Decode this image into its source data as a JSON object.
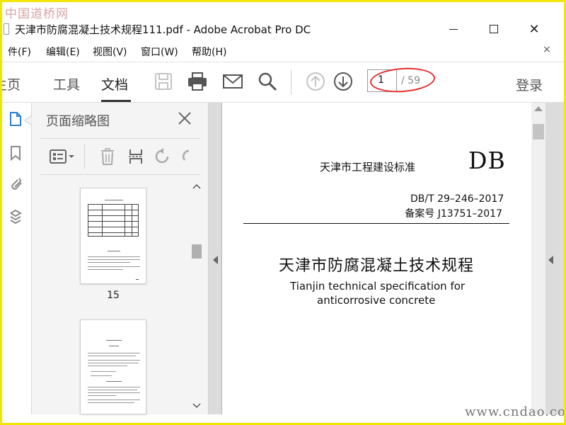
{
  "watermark_top": "中国道桥网",
  "watermark_bottom": "www.cndao.com",
  "window": {
    "title": "天津市防腐混凝土技术规程111.pdf - Adobe Acrobat Pro DC",
    "close_glyph": "✕"
  },
  "menu": {
    "items": [
      "件(F)",
      "编辑(E)",
      "视图(V)",
      "窗口(W)",
      "帮助(H)"
    ],
    "close_glyph": "×"
  },
  "toolbar": {
    "tabs": [
      "主页",
      "工具",
      "文档"
    ],
    "active_tab": "文档",
    "page_current": "1",
    "page_total": "/ 59",
    "login_label": "登录",
    "icons": [
      "save-icon",
      "print-icon",
      "email-icon",
      "search-icon",
      "page-up-icon",
      "page-down-icon"
    ]
  },
  "left_nav": {
    "icons": [
      "page-thumbnails-icon",
      "bookmarks-icon",
      "attachments-icon",
      "layers-icon"
    ]
  },
  "thumbnails": {
    "title": "页面缩略图",
    "page_label": "15",
    "tools": [
      "options-menu-icon",
      "delete-icon",
      "extract-icon",
      "rotate-ccw-icon",
      "rotate-cw-icon"
    ]
  },
  "document": {
    "standard_body": "天津市工程建设标准",
    "db_mark": "DB",
    "standard_number": "DB/T 29–246–2017",
    "record_number": "备案号 J13751–2017",
    "title_cn": "天津市防腐混凝土技术规程",
    "title_en_line1": "Tianjin technical specification for",
    "title_en_line2": "anticorrosive concrete"
  },
  "colors": {
    "frame": "#f2e600",
    "annotation_ellipse": "#e53030",
    "active_tab_underline": "#333333"
  }
}
